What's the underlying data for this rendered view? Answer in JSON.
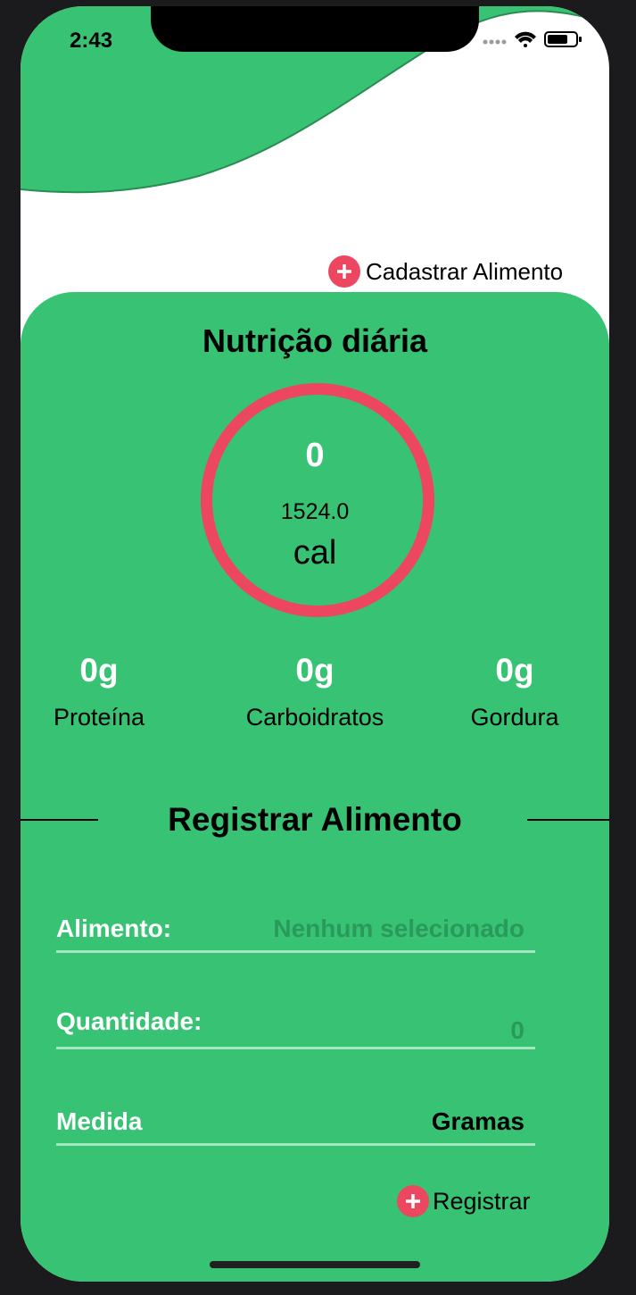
{
  "status_bar": {
    "time": "2:43"
  },
  "header": {
    "add_food_label": "Cadastrar Alimento"
  },
  "nutrition": {
    "title": "Nutrição diária",
    "calories_consumed": "0",
    "calories_goal": "1524.0",
    "calories_unit": "cal",
    "macros": [
      {
        "value": "0g",
        "label": "Proteína"
      },
      {
        "value": "0g",
        "label": "Carboidratos"
      },
      {
        "value": "0g",
        "label": "Gordura"
      }
    ]
  },
  "register_food": {
    "title": "Registrar Alimento",
    "food_label": "Alimento:",
    "food_placeholder": "Nenhum selecionado",
    "quantity_label": "Quantidade:",
    "quantity_placeholder": "0",
    "measure_label": "Medida",
    "measure_value": "Gramas",
    "register_label": "Registrar"
  },
  "colors": {
    "accent_green": "#37c373",
    "accent_red": "#ec4660",
    "placeholder_text": "#2a9a5a"
  }
}
